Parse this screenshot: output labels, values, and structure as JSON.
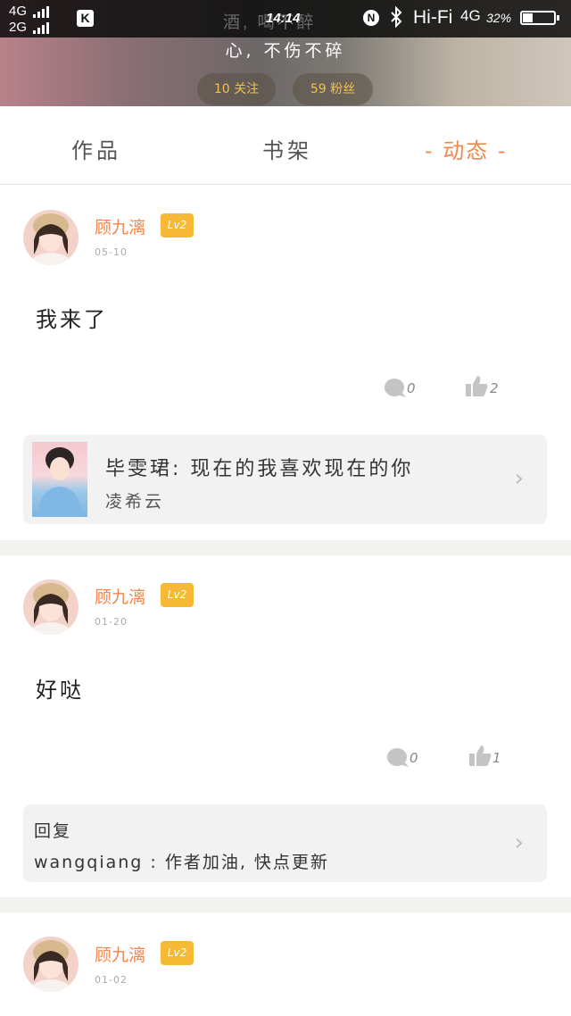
{
  "status_bar": {
    "signal_1": "4G",
    "signal_2": "2G",
    "app_icon_label": "K",
    "time": "14:14",
    "nfc_label": "N",
    "wifi_label": "Hi-Fi",
    "network": "4G",
    "battery_percent": "32%",
    "battery_level": 0.32
  },
  "profile": {
    "motto_faded": "酒, 喝不醉",
    "motto": "心, 不伤不碎",
    "following_label": "10 关注",
    "fans_label": "59 粉丝"
  },
  "tabs": [
    {
      "label": "作品",
      "active": false
    },
    {
      "label": "书架",
      "active": false
    },
    {
      "label": "- 动态 -",
      "active": true
    }
  ],
  "posts": [
    {
      "author": "顾九漓",
      "level": "Lv2",
      "date": "05-10",
      "content": "我来了",
      "comments": "0",
      "likes": "2",
      "attachment": {
        "type": "book",
        "title": "毕雯珺: 现在的我喜欢现在的你",
        "subtitle": "凌希云"
      }
    },
    {
      "author": "顾九漓",
      "level": "Lv2",
      "date": "01-20",
      "content": "好哒",
      "comments": "0",
      "likes": "1",
      "attachment": {
        "type": "reply",
        "label": "回复",
        "text": "wangqiang : 作者加油, 快点更新"
      }
    },
    {
      "author": "顾九漓",
      "level": "Lv2",
      "date": "01-02"
    }
  ],
  "colors": {
    "accent_orange": "#f0874d",
    "level_badge": "#f5b935",
    "pill_text": "#f2c24e"
  }
}
